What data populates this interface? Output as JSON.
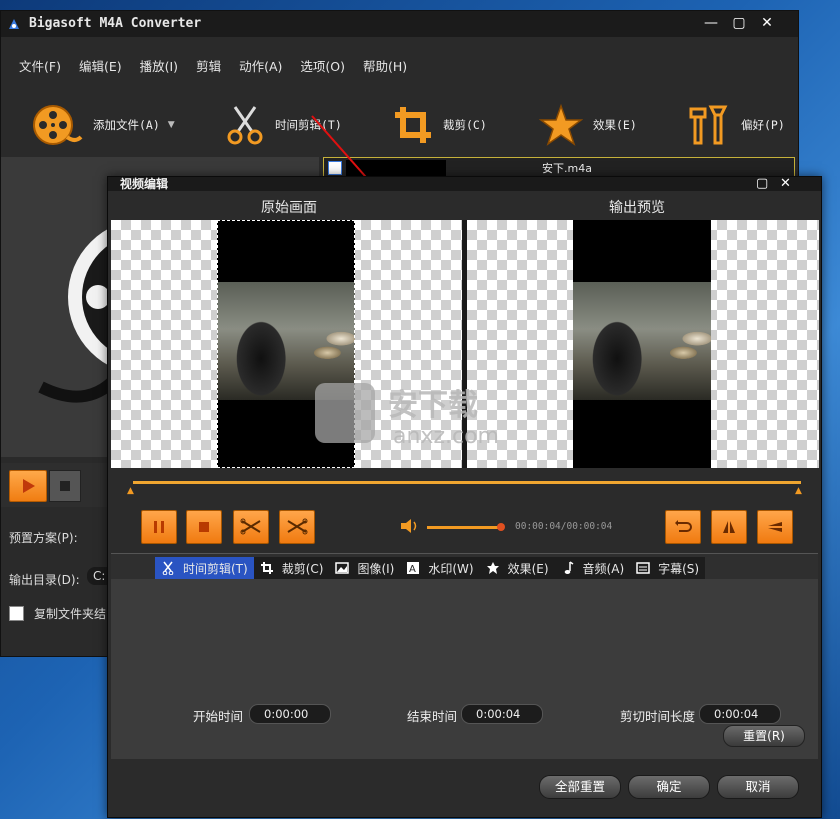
{
  "app": {
    "title": "Bigasoft M4A Converter"
  },
  "menu": [
    "文件(F)",
    "编辑(E)",
    "播放(I)",
    "剪辑",
    "动作(A)",
    "选项(O)",
    "帮助(H)"
  ],
  "toolbar": {
    "add_file": "添加文件(A)",
    "trim": "时间剪辑(T)",
    "crop": "裁剪(C)",
    "effect": "效果(E)",
    "preference": "偏好(P)"
  },
  "list": {
    "filename": "安下.m4a"
  },
  "left_panel": {
    "preset_label": "预置方案(P):",
    "output_label": "输出目录(D):",
    "output_value": "C:",
    "copy_folder_label": "复制文件夹结"
  },
  "dialog": {
    "title": "视频编辑",
    "original_label": "原始画面",
    "output_preview_label": "输出预览",
    "time_readout": "00:00:04/00:00:04",
    "tabs": [
      {
        "label": "时间剪辑(T)",
        "icon": "scissors-icon"
      },
      {
        "label": "裁剪(C)",
        "icon": "crop-icon"
      },
      {
        "label": "图像(I)",
        "icon": "image-icon"
      },
      {
        "label": "水印(W)",
        "icon": "watermark-icon"
      },
      {
        "label": "效果(E)",
        "icon": "star-icon"
      },
      {
        "label": "音频(A)",
        "icon": "music-note-icon"
      },
      {
        "label": "字幕(S)",
        "icon": "subtitle-icon"
      }
    ],
    "start_label": "开始时间",
    "start_value": "0:00:00",
    "end_label": "结束时间",
    "end_value": "0:00:04",
    "length_label": "剪切时间长度",
    "length_value": "0:00:04",
    "reset_label": "重置(R)",
    "reset_all_label": "全部重置",
    "ok_label": "确定",
    "cancel_label": "取消",
    "volume_level": 0.95
  },
  "watermark": {
    "text_cn": "安下载",
    "text_en": "anxz.com"
  },
  "colors": {
    "accent_orange": "#f28a1e",
    "tab_active": "#2a54c2",
    "list_border": "#c6b13a"
  }
}
